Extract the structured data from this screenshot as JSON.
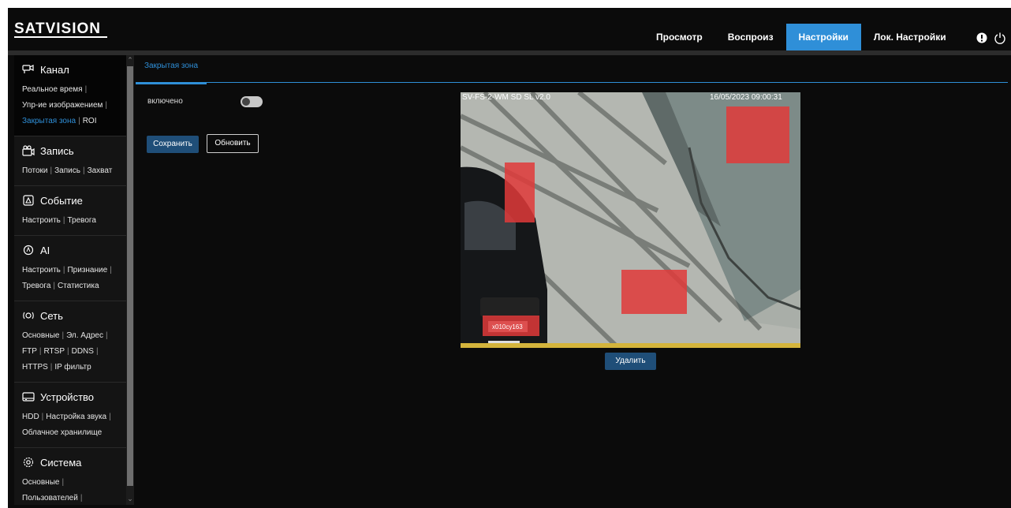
{
  "header": {
    "logo_text": "SATVISION",
    "nav": [
      "Просмотр",
      "Воспроиз",
      "Настройки",
      "Лок. Настройки"
    ],
    "active_nav": "Настройки",
    "icons": [
      "alert-icon",
      "power-icon"
    ]
  },
  "sidebar": {
    "sections": [
      {
        "title": "Канал",
        "icon": "camera-icon",
        "links": [
          [
            "Реальное время"
          ],
          [
            "Упр-ие изображением"
          ],
          [
            "Закрытая зона",
            "ROI"
          ]
        ]
      },
      {
        "title": "Запись",
        "icon": "record-icon",
        "links": [
          [
            "Потоки",
            "Запись",
            "Захват"
          ]
        ]
      },
      {
        "title": "Событие",
        "icon": "event-icon",
        "links": [
          [
            "Настроить",
            "Тревога"
          ]
        ]
      },
      {
        "title": "AI",
        "icon": "ai-icon",
        "links": [
          [
            "Настроить",
            "Признание"
          ],
          [
            "Тревога",
            "Статистика"
          ]
        ]
      },
      {
        "title": "Сеть",
        "icon": "network-icon",
        "links": [
          [
            "Основные",
            "Эл. Адрес"
          ],
          [
            "FTP",
            "RTSP",
            "DDNS"
          ],
          [
            "HTTPS",
            "IP фильтр"
          ]
        ]
      },
      {
        "title": "Устройство",
        "icon": "device-icon",
        "links": [
          [
            "HDD",
            "Настройка звука"
          ],
          [
            "Облачное хранилище"
          ]
        ]
      },
      {
        "title": "Система",
        "icon": "system-icon",
        "links": [
          [
            "Основные"
          ],
          [
            "Пользователей"
          ]
        ]
      }
    ],
    "current_link": "Закрытая зона"
  },
  "main": {
    "tab": "Закрытая зона",
    "enabled_label": "включено",
    "enabled": false,
    "save_label": "Сохранить",
    "refresh_label": "Обновить",
    "delete_label": "Удалить",
    "video": {
      "osd_left": "SV-FS-2-WM SD SL v2.0",
      "osd_right": "16/05/2023 09:00:31",
      "plate_text": "x010cy163",
      "mask_color": "#e03a3a",
      "privacy_zones": 4
    }
  },
  "colors": {
    "accent": "#2f8fd8",
    "button": "#1f4e78",
    "background": "#0b0b0b"
  }
}
